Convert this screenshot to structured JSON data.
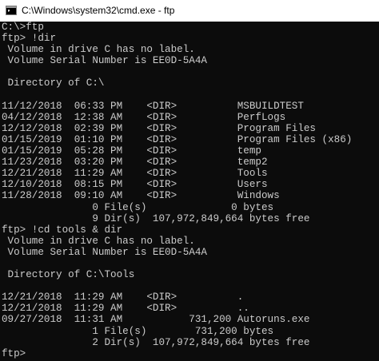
{
  "window": {
    "title": "C:\\Windows\\system32\\cmd.exe - ftp",
    "icon": "cmd-icon"
  },
  "console": {
    "lines": [
      "C:\\>ftp",
      "ftp> !dir",
      " Volume in drive C has no label.",
      " Volume Serial Number is EE0D-5A4A",
      "",
      " Directory of C:\\",
      "",
      "11/12/2018  06:33 PM    <DIR>          MSBUILDTEST",
      "04/12/2018  12:38 AM    <DIR>          PerfLogs",
      "12/12/2018  02:39 PM    <DIR>          Program Files",
      "01/15/2019  01:10 PM    <DIR>          Program Files (x86)",
      "01/15/2019  05:28 PM    <DIR>          temp",
      "11/23/2018  03:20 PM    <DIR>          temp2",
      "12/21/2018  11:29 AM    <DIR>          Tools",
      "12/10/2018  08:15 PM    <DIR>          Users",
      "11/28/2018  09:10 AM    <DIR>          Windows",
      "               0 File(s)              0 bytes",
      "               9 Dir(s)  107,972,849,664 bytes free",
      "ftp> !cd tools & dir",
      " Volume in drive C has no label.",
      " Volume Serial Number is EE0D-5A4A",
      "",
      " Directory of C:\\Tools",
      "",
      "12/21/2018  11:29 AM    <DIR>          .",
      "12/21/2018  11:29 AM    <DIR>          ..",
      "09/27/2018  11:31 AM           731,200 Autoruns.exe",
      "               1 File(s)        731,200 bytes",
      "               2 Dir(s)  107,972,849,664 bytes free",
      "ftp>"
    ]
  }
}
